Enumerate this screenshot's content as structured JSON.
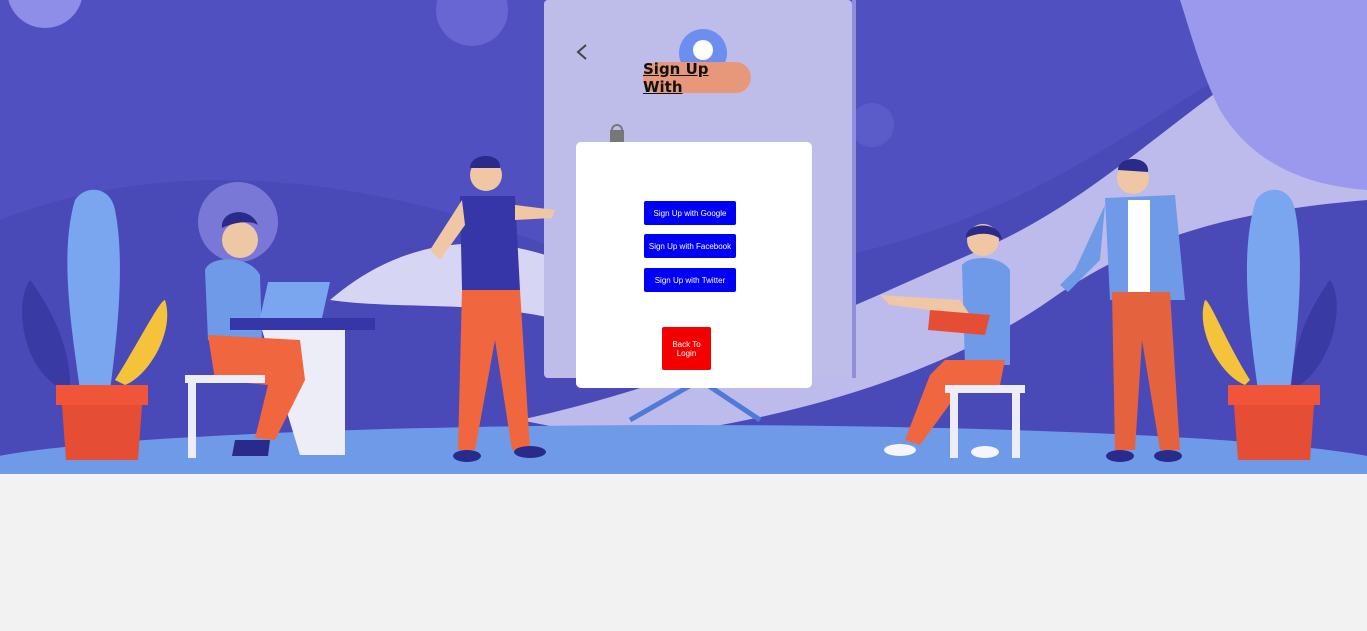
{
  "header": {
    "title": "Sign Up With"
  },
  "signup_options": [
    {
      "label": "Sign Up with Google"
    },
    {
      "label": "Sign Up with Facebook"
    },
    {
      "label": "Sign Up with Twitter"
    }
  ],
  "back_button": {
    "label": "Back To Login"
  },
  "colors": {
    "hero_background": "#5150c0",
    "title_pill": "#e8987a",
    "social_button": "#0000f5",
    "back_button": "#f50000",
    "page_background": "#f2f2f2"
  },
  "icons": [
    "back-chevron-icon",
    "location-pin-icon",
    "lock-icon"
  ]
}
